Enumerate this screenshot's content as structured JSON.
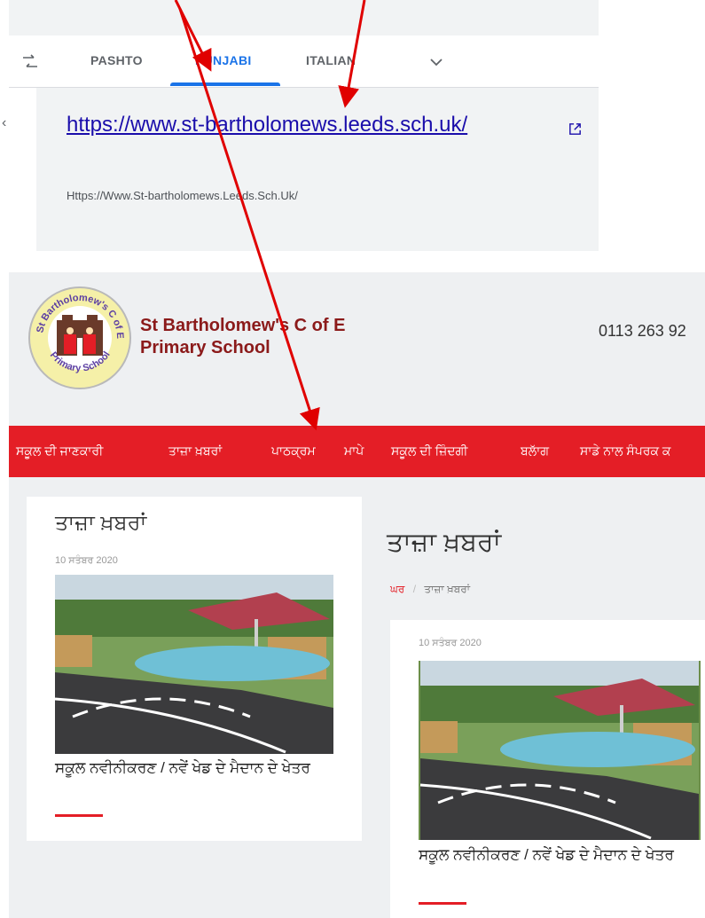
{
  "translate": {
    "tabs": [
      "PASHTO",
      "PUNJABI",
      "ITALIAN"
    ],
    "active_tab": "PUNJABI",
    "result_link": "https://www.st-bartholomews.leeds.sch.uk/",
    "result_url_text": "Https://Www.St-bartholomews.Leeds.Sch.Uk/",
    "icons": [
      "swap-icon",
      "chevron-down-icon",
      "external-link-icon",
      "chevron-left-icon"
    ]
  },
  "school": {
    "name_line1": "St Bartholomew's C of E",
    "name_line2": "Primary School",
    "phone": "0113 263 92",
    "logo_text_top": "St Bartholomew's C of E",
    "logo_text_bottom": "Primary School"
  },
  "nav": {
    "items": [
      "ਸਕੂਲ ਦੀ ਜਾਣਕਾਰੀ",
      "ਤਾਜ਼ਾ ਖ਼ਬਰਾਂ",
      "ਪਾਠਕ੍ਰਮ",
      "ਮਾਪੇ",
      "ਸਕੂਲ ਦੀ ਜ਼ਿੰਦਗੀ",
      "ਬਲਾੱਗ",
      "ਸਾਡੇ ਨਾਲ ਸੰਪਰਕ ਕ"
    ]
  },
  "sidebar_card": {
    "title": "ਤਾਜ਼ਾ ਖ਼ਬਰਾਂ",
    "date": "10 ਸਤੰਬਰ 2020",
    "caption": "ਸਕੂਲ ਨਵੀਨੀਕਰਣ / ਨਵੇਂ ਖੇਡ ਦੇ ਮੈਦਾਨ ਦੇ ਖੇਤਰ"
  },
  "main": {
    "title": "ਤਾਜ਼ਾ ਖ਼ਬਰਾਂ",
    "breadcrumb_home": "ਘਰ",
    "breadcrumb_sep": "/",
    "breadcrumb_current": "ਤਾਜ਼ਾ ਖ਼ਬਰਾਂ",
    "post_date": "10 ਸਤੰਬਰ 2020",
    "post_caption": "ਸਕੂਲ ਨਵੀਨੀਕਰਣ / ਨਵੇਂ ਖੇਡ ਦੇ ਮੈਦਾਨ ਦੇ ਖੇਤਰ"
  },
  "colors": {
    "brand_red": "#e41e26",
    "school_maroon": "#8b1a1a",
    "link_blue": "#1a0dab",
    "tab_blue": "#1a73e8",
    "annotation_arrow": "#e00000"
  }
}
